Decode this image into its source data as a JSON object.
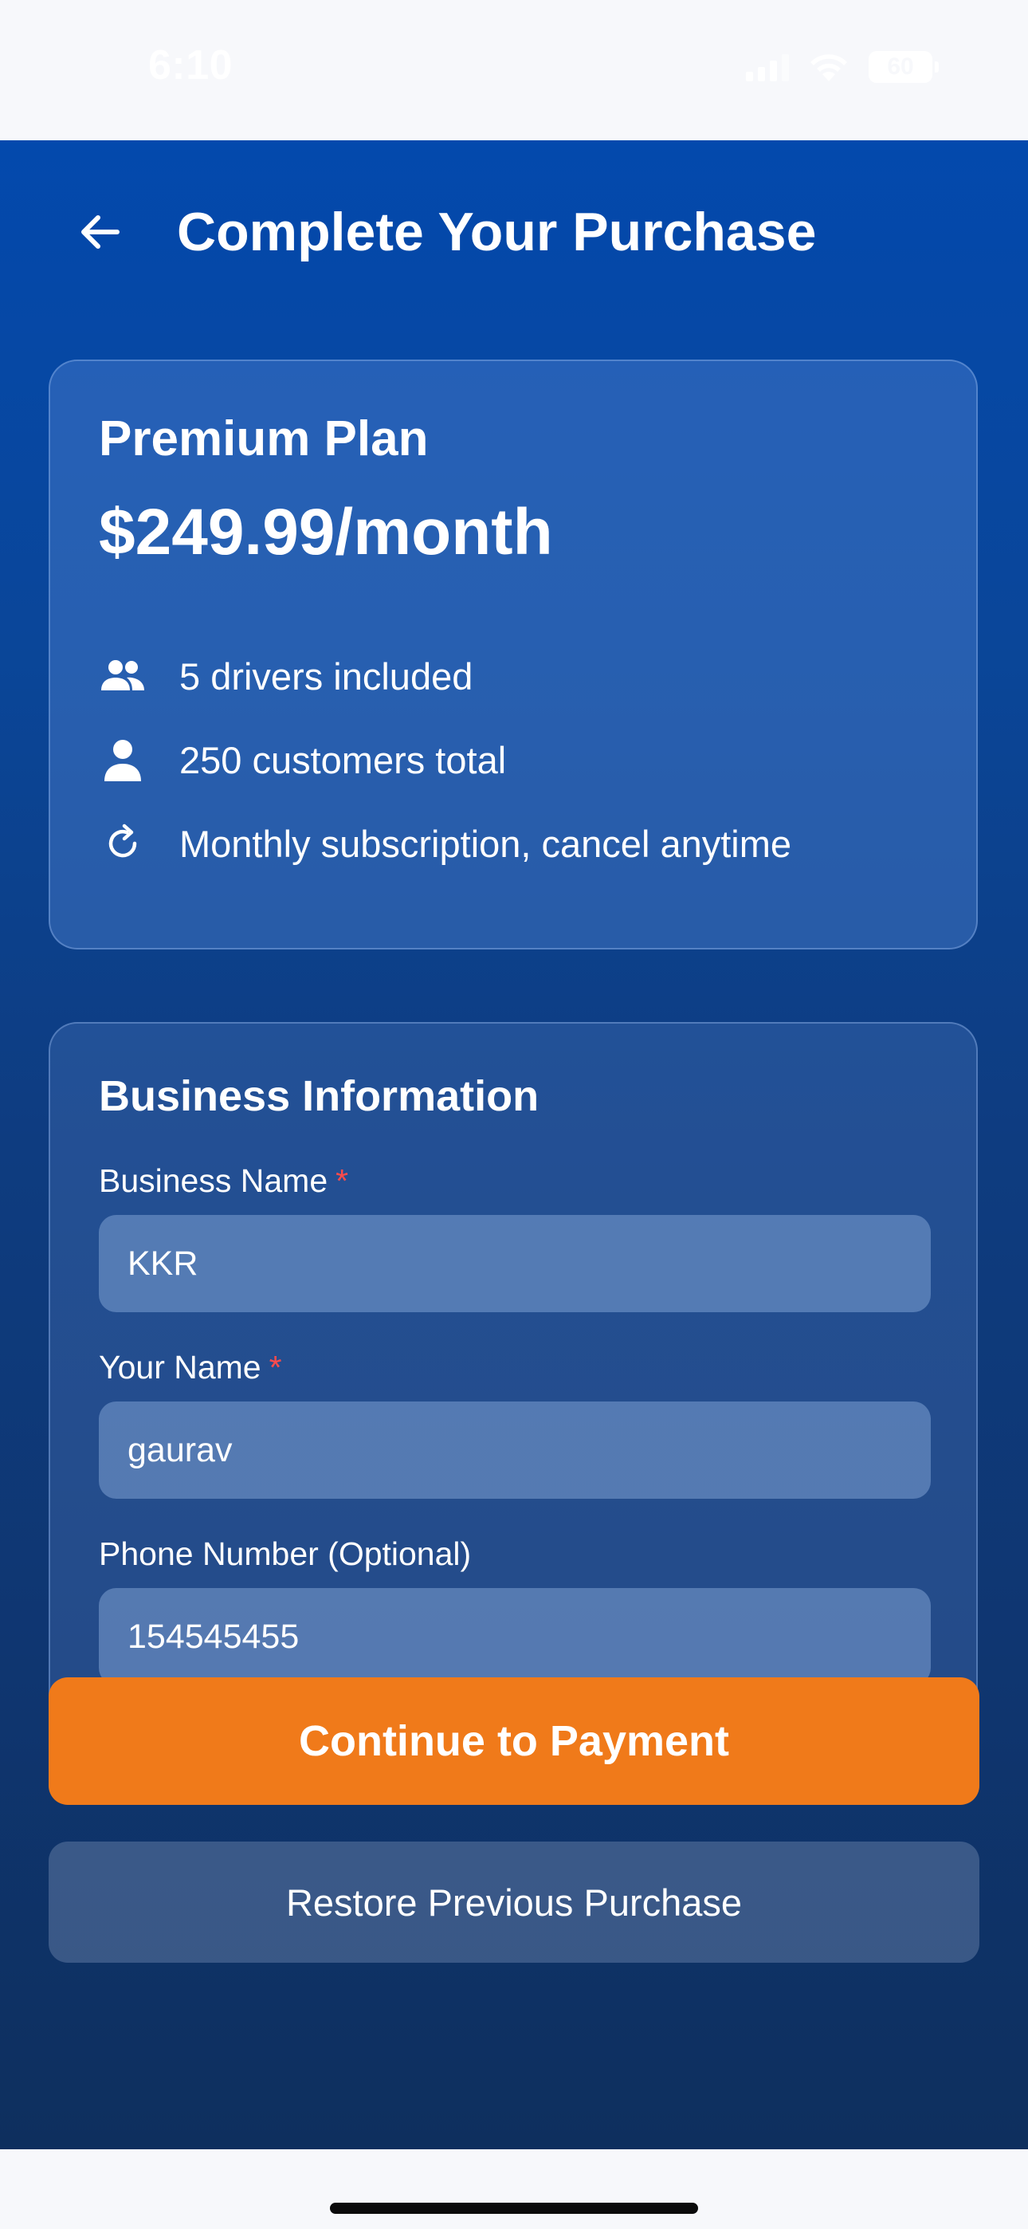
{
  "status_bar": {
    "time": "6:10",
    "battery": "60"
  },
  "header": {
    "title": "Complete Your Purchase"
  },
  "plan": {
    "name": "Premium Plan",
    "price": "$249.99/month",
    "features": [
      {
        "icon": "group-icon",
        "text": "5 drivers included"
      },
      {
        "icon": "person-icon",
        "text": "250 customers total"
      },
      {
        "icon": "refresh-icon",
        "text": "Monthly subscription, cancel anytime"
      }
    ]
  },
  "business": {
    "title": "Business Information",
    "fields": [
      {
        "label": "Business Name",
        "required": "*",
        "value": "KKR"
      },
      {
        "label": "Your Name",
        "required": "*",
        "value": "gaurav"
      },
      {
        "label": "Phone Number (Optional)",
        "value": "154545455"
      }
    ]
  },
  "actions": {
    "continue_label": "Continue to Payment",
    "restore_label": "Restore Previous Purchase"
  },
  "colors": {
    "primary_button": "#f07a1a",
    "required_star": "#ff4b4b",
    "background_top": "#0349ad",
    "background_bottom": "#0e2f5e"
  }
}
